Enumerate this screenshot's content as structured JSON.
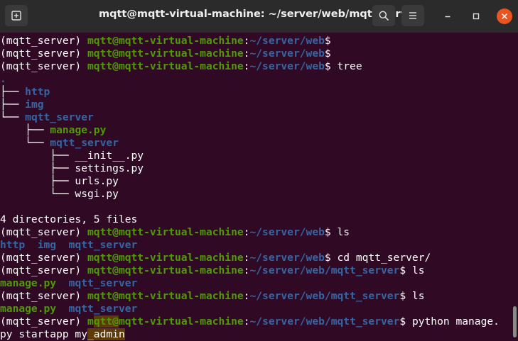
{
  "window": {
    "title": "mqtt@mqtt-virtual-machine: ~/server/web/mqtt_server",
    "icons": {
      "new_tab": "new-tab-icon",
      "search": "search-icon",
      "menu": "hamburger-menu-icon",
      "minimize": "minimize-icon",
      "maximize": "maximize-icon",
      "close": "close-icon"
    }
  },
  "colors": {
    "background": "#300a24",
    "user_host": "#4e9a06",
    "path": "#3465a4",
    "text": "#ffffff",
    "close_button": "#e95420",
    "highlight": "#5e3a06"
  },
  "terminal": {
    "lines": [
      [
        {
          "t": "(mqtt_server) ",
          "c": "t"
        },
        {
          "t": "mqtt@mqtt-virtual-machine",
          "c": "g"
        },
        {
          "t": ":",
          "c": "t"
        },
        {
          "t": "~/server/web",
          "c": "b"
        },
        {
          "t": "$",
          "c": "t"
        }
      ],
      [
        {
          "t": "(mqtt_server) ",
          "c": "t"
        },
        {
          "t": "mqtt@mqtt-virtual-machine",
          "c": "g"
        },
        {
          "t": ":",
          "c": "t"
        },
        {
          "t": "~/server/web",
          "c": "b"
        },
        {
          "t": "$",
          "c": "t"
        }
      ],
      [
        {
          "t": "(mqtt_server) ",
          "c": "t"
        },
        {
          "t": "mqtt@mqtt-virtual-machine",
          "c": "g"
        },
        {
          "t": ":",
          "c": "t"
        },
        {
          "t": "~/server/web",
          "c": "b"
        },
        {
          "t": "$ tree",
          "c": "t"
        }
      ],
      [
        {
          "t": ".",
          "c": "b"
        }
      ],
      [
        {
          "t": "├── ",
          "c": "t"
        },
        {
          "t": "http",
          "c": "b"
        }
      ],
      [
        {
          "t": "├── ",
          "c": "t"
        },
        {
          "t": "img",
          "c": "b"
        }
      ],
      [
        {
          "t": "└── ",
          "c": "t"
        },
        {
          "t": "mqtt_server",
          "c": "b"
        }
      ],
      [
        {
          "t": "    ├── ",
          "c": "t"
        },
        {
          "t": "manage.py",
          "c": "g"
        }
      ],
      [
        {
          "t": "    └── ",
          "c": "t"
        },
        {
          "t": "mqtt_server",
          "c": "b"
        }
      ],
      [
        {
          "t": "        ├── __init__.py",
          "c": "t"
        }
      ],
      [
        {
          "t": "        ├── settings.py",
          "c": "t"
        }
      ],
      [
        {
          "t": "        ├── urls.py",
          "c": "t"
        }
      ],
      [
        {
          "t": "        └── wsgi.py",
          "c": "t"
        }
      ],
      [
        {
          "t": "",
          "c": "t"
        }
      ],
      [
        {
          "t": "4 directories, 5 files",
          "c": "t"
        }
      ],
      [
        {
          "t": "(mqtt_server) ",
          "c": "t"
        },
        {
          "t": "mqtt@mqtt-virtual-machine",
          "c": "g"
        },
        {
          "t": ":",
          "c": "t"
        },
        {
          "t": "~/server/web",
          "c": "b"
        },
        {
          "t": "$ ls",
          "c": "t"
        }
      ],
      [
        {
          "t": "http",
          "c": "b"
        },
        {
          "t": "  ",
          "c": "t"
        },
        {
          "t": "img",
          "c": "b"
        },
        {
          "t": "  ",
          "c": "t"
        },
        {
          "t": "mqtt_server",
          "c": "b"
        }
      ],
      [
        {
          "t": "(mqtt_server) ",
          "c": "t"
        },
        {
          "t": "mqtt@mqtt-virtual-machine",
          "c": "g"
        },
        {
          "t": ":",
          "c": "t"
        },
        {
          "t": "~/server/web",
          "c": "b"
        },
        {
          "t": "$ cd mqtt_server/",
          "c": "t"
        }
      ],
      [
        {
          "t": "(mqtt_server) ",
          "c": "t"
        },
        {
          "t": "mqtt@mqtt-virtual-machine",
          "c": "g"
        },
        {
          "t": ":",
          "c": "t"
        },
        {
          "t": "~/server/web/mqtt_server",
          "c": "b"
        },
        {
          "t": "$ ls",
          "c": "t"
        }
      ],
      [
        {
          "t": "manage.py",
          "c": "g"
        },
        {
          "t": "  ",
          "c": "t"
        },
        {
          "t": "mqtt_server",
          "c": "b"
        }
      ],
      [
        {
          "t": "(mqtt_server) ",
          "c": "t"
        },
        {
          "t": "mqtt@mqtt-virtual-machine",
          "c": "g"
        },
        {
          "t": ":",
          "c": "t"
        },
        {
          "t": "~/server/web/mqtt_server",
          "c": "b"
        },
        {
          "t": "$ ls",
          "c": "t"
        }
      ],
      [
        {
          "t": "manage.py",
          "c": "g"
        },
        {
          "t": "  ",
          "c": "t"
        },
        {
          "t": "mqtt_server",
          "c": "b"
        }
      ],
      [
        {
          "t": "(mqtt_server) ",
          "c": "t"
        },
        {
          "t": "m",
          "c": "g"
        },
        {
          "t": "qtt@",
          "c": "g hl"
        },
        {
          "t": "mqtt-virtual-machine",
          "c": "g"
        },
        {
          "t": ":",
          "c": "t"
        },
        {
          "t": "~/server/web/mqtt_server",
          "c": "b"
        },
        {
          "t": "$ python manage.",
          "c": "t"
        }
      ],
      [
        {
          "t": "py startapp my",
          "c": "t"
        },
        {
          "t": "_admin",
          "c": "t hl"
        }
      ]
    ]
  }
}
